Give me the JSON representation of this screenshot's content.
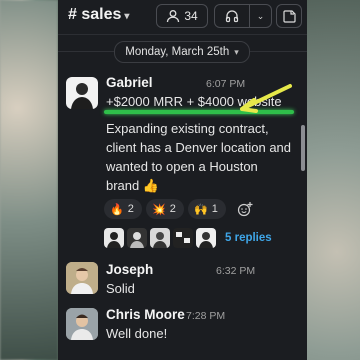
{
  "header": {
    "channel": "# sales",
    "member_count": "34"
  },
  "date_divider": "Monday, March 25th",
  "messages": [
    {
      "author": "Gabriel",
      "time": "6:07 PM",
      "lines": [
        "+$2000 MRR + $4000 website",
        "Expanding existing contract,",
        "client has a Denver location and",
        "wanted to open a Houston",
        "brand 👍"
      ]
    },
    {
      "author": "Joseph",
      "time": "6:32 PM",
      "lines": [
        "Solid"
      ]
    },
    {
      "author": "Chris Moore",
      "time": "7:28 PM",
      "lines": [
        "Well done!"
      ]
    }
  ],
  "reactions": [
    {
      "emoji": "🔥",
      "count": "2"
    },
    {
      "emoji": "💥",
      "count": "2"
    },
    {
      "emoji": "🙌",
      "count": "1"
    }
  ],
  "thread": {
    "replies_label": "5 replies"
  },
  "colors": {
    "highlight": "#2fbf4a",
    "arrow": "#e6e84a",
    "link": "#3fa6e8"
  }
}
